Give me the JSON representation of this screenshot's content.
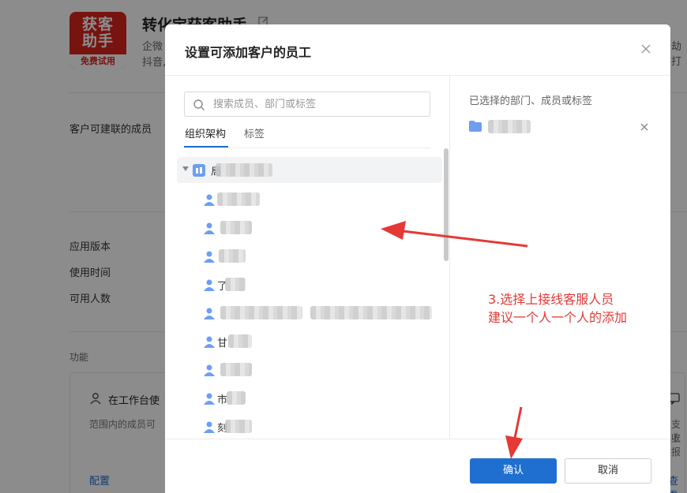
{
  "background": {
    "logo_line1": "获客",
    "logo_line2": "助手",
    "logo_line3": "免费试用",
    "title": "转化宝获客助手",
    "desc_line1": "企微",
    "desc_line2": "抖音,",
    "desc_right": "劫打",
    "label_members": "客户可建联的成员",
    "label_version": "应用版本",
    "label_time": "使用时间",
    "label_users": "可用人数",
    "section_features": "功能",
    "card_title": "在工作台使",
    "card_desc": "范围内的成员可",
    "card_link": "配置",
    "right_text1": "支收",
    "right_text2": "上报",
    "right_link": "查看"
  },
  "modal": {
    "title": "设置可添加客户的员工",
    "search_placeholder": "搜索成员、部门或标签",
    "tabs": [
      {
        "label": "组织架构",
        "active": true
      },
      {
        "label": "标签",
        "active": false
      }
    ],
    "root_dept_prefix": "局",
    "members": [
      {
        "prefix": ""
      },
      {
        "prefix": ""
      },
      {
        "prefix": ""
      },
      {
        "prefix": "了"
      },
      {
        "prefix": ""
      },
      {
        "prefix": "甘"
      },
      {
        "prefix": ""
      },
      {
        "prefix": "市"
      },
      {
        "prefix": "刻"
      }
    ],
    "selected_title": "已选择的部门、成员或标签",
    "confirm_label": "确认",
    "cancel_label": "取消"
  },
  "annotation": {
    "line1": "3.选择上接线客服人员",
    "line2": "建议一个人一个人的添加",
    "color": "#e53935"
  },
  "colors": {
    "primary": "#1f6fd1",
    "logo_red": "#d9251d"
  }
}
